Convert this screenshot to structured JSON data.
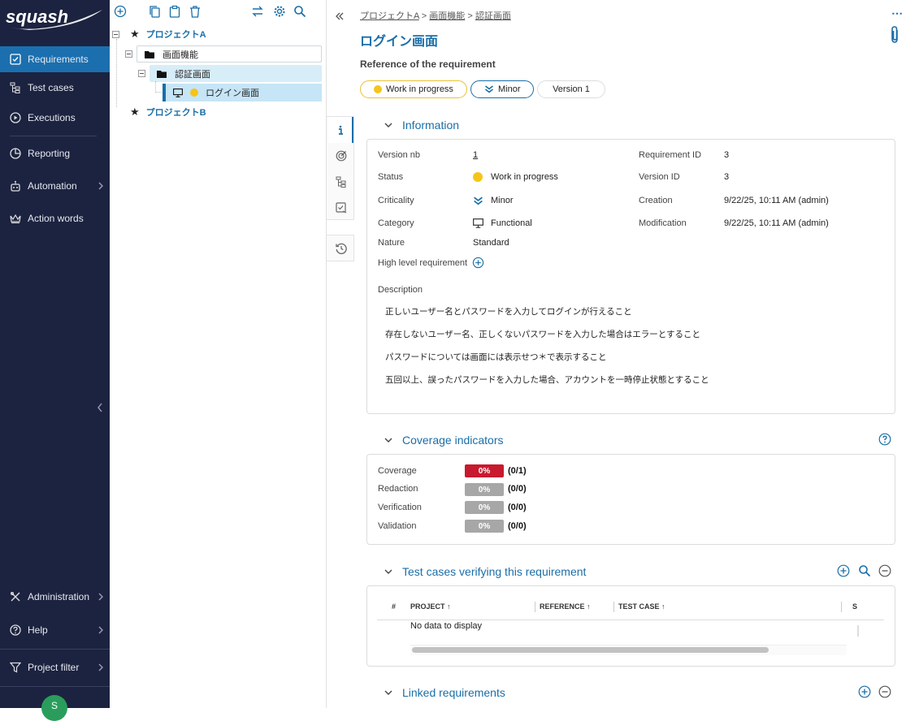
{
  "app": {
    "logo_text": "squash"
  },
  "sidebar": {
    "items": [
      {
        "label": "Requirements",
        "icon": "requirements-icon"
      },
      {
        "label": "Test cases",
        "icon": "test-cases-icon"
      },
      {
        "label": "Executions",
        "icon": "executions-icon"
      },
      {
        "label": "Reporting",
        "icon": "reporting-icon"
      },
      {
        "label": "Automation",
        "icon": "automation-icon"
      },
      {
        "label": "Action words",
        "icon": "action-words-icon"
      },
      {
        "label": "Administration",
        "icon": "administration-icon"
      },
      {
        "label": "Help",
        "icon": "help-icon"
      },
      {
        "label": "Project filter",
        "icon": "filter-icon"
      }
    ],
    "user_initial": "S"
  },
  "tree": {
    "nodes": [
      {
        "label": "プロジェクトA"
      },
      {
        "label": "画面機能"
      },
      {
        "label": "認証画面"
      },
      {
        "label": "ログイン画面"
      },
      {
        "label": "プロジェクトB"
      }
    ]
  },
  "breadcrumb": [
    "プロジェクトA",
    "画面機能",
    "認証画面"
  ],
  "breadcrumb_sep": ">",
  "requirement": {
    "title": "ログイン画面",
    "reference": "Reference of the requirement",
    "status_pill": "Work in progress",
    "criticality_pill": "Minor",
    "version_pill": "Version 1"
  },
  "information": {
    "heading": "Information",
    "version_nb_label": "Version nb",
    "version_nb": "1",
    "status_label": "Status",
    "status": "Work in progress",
    "criticality_label": "Criticality",
    "criticality": "Minor",
    "category_label": "Category",
    "category": "Functional",
    "nature_label": "Nature",
    "nature": "Standard",
    "high_level_label": "High level requirement",
    "requirement_id_label": "Requirement ID",
    "requirement_id": "3",
    "version_id_label": "Version ID",
    "version_id": "3",
    "creation_label": "Creation",
    "creation": "9/22/25, 10:11 AM (admin)",
    "modification_label": "Modification",
    "modification": "9/22/25, 10:11 AM (admin)",
    "description_label": "Description",
    "description_lines": [
      "正しいユーザー名とパスワードを入力してログインが行えること",
      "存在しないユーザー名、正しくないパスワードを入力した場合はエラーとすること",
      "パスワードについては画面には表示せつ＊で表示すること",
      "五回以上、誤ったパスワードを入力した場合、アカウントを一時停止状態とすること"
    ]
  },
  "coverage": {
    "heading": "Coverage indicators",
    "rows": [
      {
        "label": "Coverage",
        "percent": "0%",
        "fraction": "(0/1)",
        "color": "#c8192e"
      },
      {
        "label": "Redaction",
        "percent": "0%",
        "fraction": "(0/0)",
        "color": "#a7a7a7"
      },
      {
        "label": "Verification",
        "percent": "0%",
        "fraction": "(0/0)",
        "color": "#a7a7a7"
      },
      {
        "label": "Validation",
        "percent": "0%",
        "fraction": "(0/0)",
        "color": "#a7a7a7"
      }
    ]
  },
  "test_cases": {
    "heading": "Test cases verifying this requirement",
    "columns": [
      "#",
      "PROJECT",
      "REFERENCE",
      "TEST CASE",
      "S"
    ],
    "empty_text": "No data to display"
  },
  "linked": {
    "heading": "Linked requirements"
  },
  "colors": {
    "sidebar_bg": "#1c2340",
    "accent": "#1a6ea8",
    "active_nav": "#1b6fae",
    "status_yellow": "#f5c518"
  }
}
